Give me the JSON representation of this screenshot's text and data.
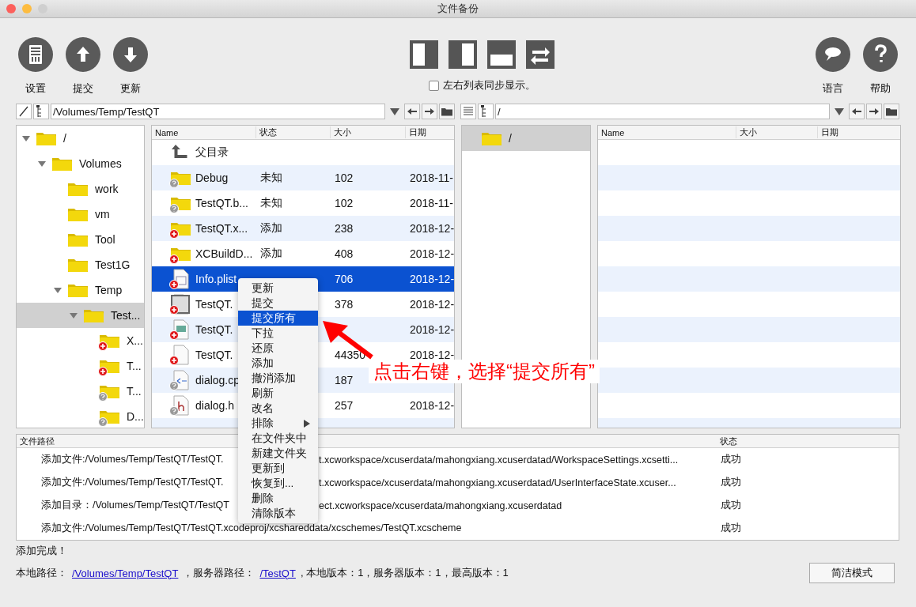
{
  "window": {
    "title": "文件备份"
  },
  "toolbar_left": [
    {
      "label": "设置",
      "kind": "list"
    },
    {
      "label": "提交",
      "kind": "up"
    },
    {
      "label": "更新",
      "kind": "down"
    }
  ],
  "layout_buttons": [
    {
      "kind": "left"
    },
    {
      "kind": "right"
    },
    {
      "kind": "bottom"
    },
    {
      "kind": "swap"
    }
  ],
  "sync_checkbox": {
    "label": "左右列表同步显示。",
    "checked": false
  },
  "toolbar_right": [
    {
      "label": "语言",
      "kind": "speech"
    },
    {
      "label": "帮助",
      "kind": "help"
    }
  ],
  "left_path": {
    "kind": "edit",
    "value": "/Volumes/Temp/TestQT"
  },
  "right_path": {
    "kind": "list",
    "value": "/"
  },
  "left_tree": [
    {
      "name": "/",
      "kind": "folder",
      "expanded": true,
      "selected": false,
      "children": [
        {
          "name": "Volumes",
          "kind": "folder",
          "expanded": true,
          "selected": false,
          "children": [
            {
              "name": "work",
              "kind": "folder",
              "selected": false
            },
            {
              "name": "vm",
              "kind": "folder",
              "selected": false
            },
            {
              "name": "Tool",
              "kind": "folder",
              "selected": false
            },
            {
              "name": "Test1G",
              "kind": "folder",
              "selected": false
            },
            {
              "name": "Temp",
              "kind": "folder",
              "expanded": true,
              "selected": false,
              "children": [
                {
                  "name": "Test...",
                  "kind": "folder",
                  "expanded": true,
                  "selected": true,
                  "children": [
                    {
                      "name": "X...",
                      "kind": "folder_added",
                      "selected": false
                    },
                    {
                      "name": "T...",
                      "kind": "folder_added",
                      "selected": false
                    },
                    {
                      "name": "T...",
                      "kind": "folder_unknown",
                      "selected": false
                    },
                    {
                      "name": "D...",
                      "kind": "folder_unknown",
                      "selected": false
                    }
                  ]
                }
              ]
            }
          ]
        }
      ]
    }
  ],
  "file_table": {
    "columns": [
      "Name",
      "状态",
      "大小",
      "日期"
    ],
    "rows": [
      {
        "kind": "up",
        "name": "父目录",
        "selected": false
      },
      {
        "kind": "folder_unknown",
        "name": "Debug",
        "status": "未知",
        "size": "102",
        "date": "2018-11-",
        "selected": false
      },
      {
        "kind": "folder_unknown",
        "name": "TestQT.b...",
        "status": "未知",
        "size": "102",
        "date": "2018-11-",
        "selected": false
      },
      {
        "kind": "folder_added",
        "name": "TestQT.x...",
        "status": "添加",
        "size": "238",
        "date": "2018-12-",
        "selected": false
      },
      {
        "kind": "folder_added",
        "name": "XCBuildD...",
        "status": "添加",
        "size": "408",
        "date": "2018-12-",
        "selected": false
      },
      {
        "kind": "sheet_added",
        "name": "Info.plist",
        "size": "706",
        "date": "2018-12-",
        "selected": true
      },
      {
        "kind": "image_added",
        "name": "TestQT.",
        "size": "378",
        "date": "2018-12-",
        "selected": false
      },
      {
        "kind": "package_added",
        "name": "TestQT.",
        "date": "2018-12-",
        "selected": false
      },
      {
        "kind": "file_added",
        "name": "TestQT.",
        "size": "44350",
        "date": "2018-12-",
        "selected": false
      },
      {
        "kind": "code_unknown",
        "name": "dialog.cp",
        "size": "187",
        "selected": false
      },
      {
        "kind": "header_unknown",
        "name": "dialog.h",
        "size": "257",
        "date": "2018-12-",
        "selected": false
      }
    ]
  },
  "right_tree": [
    {
      "name": "/",
      "kind": "folder",
      "selected": true
    }
  ],
  "right_table": {
    "columns": [
      "Name",
      "大小",
      "日期"
    ]
  },
  "context_menu": [
    {
      "label": "更新",
      "selected": false,
      "submenu": false
    },
    {
      "label": "提交",
      "selected": false,
      "submenu": false
    },
    {
      "label": "提交所有",
      "selected": true,
      "submenu": false
    },
    {
      "label": "下拉",
      "selected": false,
      "submenu": false
    },
    {
      "label": "还原",
      "selected": false,
      "submenu": false
    },
    {
      "label": "添加",
      "selected": false,
      "submenu": false
    },
    {
      "label": "撤消添加",
      "selected": false,
      "submenu": false
    },
    {
      "label": "刷新",
      "selected": false,
      "submenu": false
    },
    {
      "label": "改名",
      "selected": false,
      "submenu": false
    },
    {
      "label": "排除",
      "selected": false,
      "submenu": true
    },
    {
      "label": "在文件夹中",
      "selected": false,
      "submenu": false
    },
    {
      "label": "新建文件夹",
      "selected": false,
      "submenu": false
    },
    {
      "label": "更新到",
      "selected": false,
      "submenu": false
    },
    {
      "label": "恢复到...",
      "selected": false,
      "submenu": false
    },
    {
      "label": "删除",
      "selected": false,
      "submenu": false
    },
    {
      "label": "清除版本",
      "selected": false,
      "submenu": false
    }
  ],
  "callout": "点击右键，选择“提交所有”",
  "log": {
    "columns": [
      "文件路径",
      "状态"
    ],
    "rows": [
      {
        "path_start": "添加文件:/Volumes/Temp/TestQT/TestQT.",
        "path_end": "t.xcworkspace/xcuserdata/mahongxiang.xcuserdatad/WorkspaceSettings.xcsetti...",
        "status": "成功"
      },
      {
        "path_start": "添加文件:/Volumes/Temp/TestQT/TestQT.",
        "path_end": "t.xcworkspace/xcuserdata/mahongxiang.xcuserdatad/UserInterfaceState.xcuser...",
        "status": "成功"
      },
      {
        "path_start": "添加目录：/Volumes/Temp/TestQT/TestQT",
        "path_end": "ect.xcworkspace/xcuserdata/mahongxiang.xcuserdatad",
        "status": "成功"
      },
      {
        "path": "添加文件:/Volumes/Temp/TestQT/TestQT.xcodeproj/xcshareddata/xcschemes/TestQT.xcscheme",
        "status": "成功"
      }
    ]
  },
  "status_message": "添加完成！",
  "info_line": [
    {
      "kind": "label",
      "text": "本地路径："
    },
    {
      "kind": "link",
      "text": "/Volumes/Temp/TestQT"
    },
    {
      "kind": "label",
      "text": "，服务器路径："
    },
    {
      "kind": "link",
      "text": "/TestQT"
    },
    {
      "kind": "label",
      "text": ", 本地版本：1，服务器版本：1，最高版本：1"
    }
  ],
  "mode_button": "简洁模式"
}
